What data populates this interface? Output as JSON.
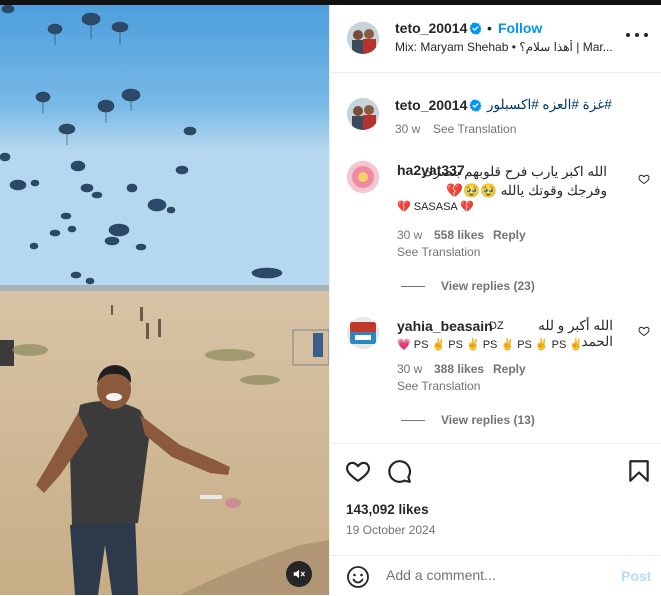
{
  "post": {
    "author": "teto_20014",
    "follow_label": "Follow",
    "dot": "•",
    "audio_line": "Mix: Maryam Shehab • أهذا سلام؟ | Mar..."
  },
  "caption": {
    "username": "teto_20014",
    "text": "#غزة #العزه #اكسبلور",
    "age": "30 w",
    "see_translation": "See Translation"
  },
  "comments": [
    {
      "username": "ha2yat337",
      "text": "الله اكبر يارب فرح قلوبهم بنصرك وفرجك وقوتك يالله 🥹🥹💔",
      "extra": "💔 SASASA 💔",
      "age": "30 w",
      "likes": "558 likes",
      "reply": "Reply",
      "see_translation": "See Translation",
      "view_replies": "View replies (23)"
    },
    {
      "username": "yahia_beasain",
      "badge": "DZ",
      "text": "الله أكبر و لله الحمد",
      "extra": "💗 PS ✌️ PS ✌️ PS ✌️ PS ✌️ PS ✌️",
      "age": "30 w",
      "likes": "388 likes",
      "reply": "Reply",
      "see_translation": "See Translation",
      "view_replies": "View replies (13)"
    }
  ],
  "footer": {
    "likes": "143,092 likes",
    "date": "19 October 2024",
    "comment_placeholder": "Add a comment...",
    "post_label": "Post"
  },
  "colors": {
    "accent": "#0095f6",
    "verified": "#0095f6",
    "hashtag": "#00376b",
    "muted": "#737373"
  }
}
